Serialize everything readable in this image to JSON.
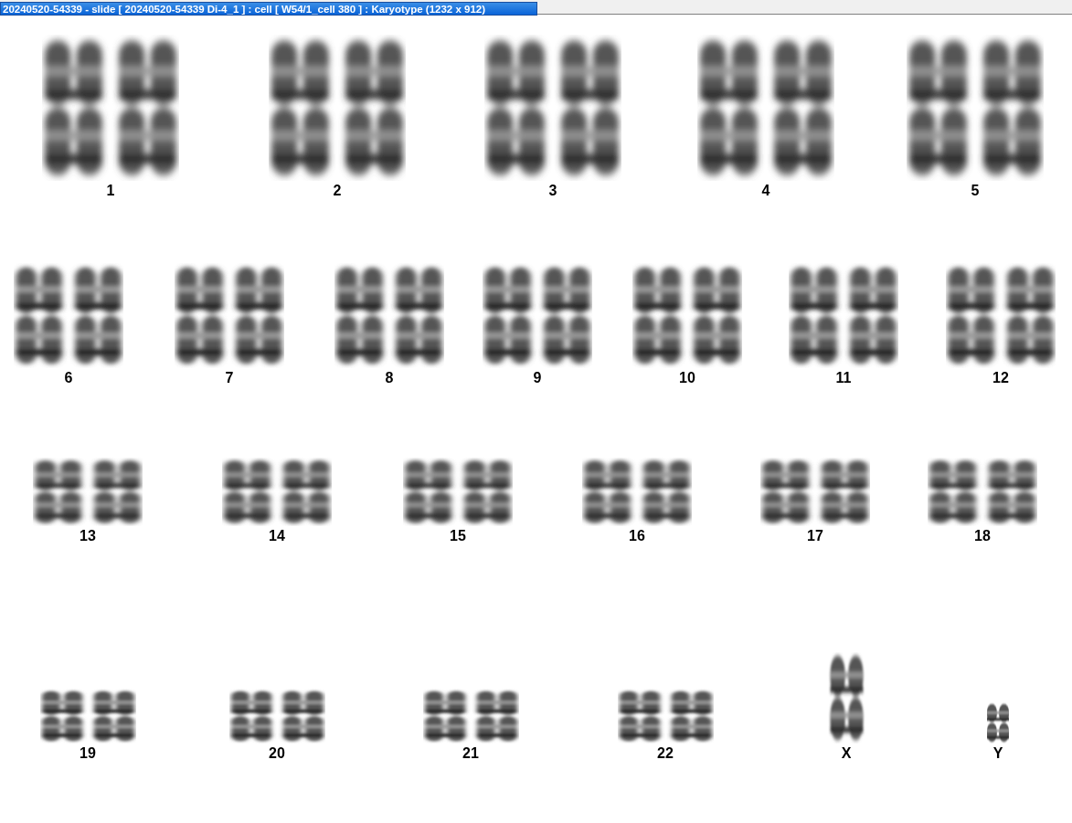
{
  "window": {
    "title": "20240520-54339 - slide [ 20240520-54339 Di-4_1 ] : cell [ W54/1_cell 380 ] : Karyotype  (1232 x 912)"
  },
  "rows": [
    {
      "chromosomes": [
        {
          "label": "1",
          "kind": "pair"
        },
        {
          "label": "2",
          "kind": "pair"
        },
        {
          "label": "3",
          "kind": "pair"
        },
        {
          "label": "4",
          "kind": "pair"
        },
        {
          "label": "5",
          "kind": "pair"
        }
      ]
    },
    {
      "chromosomes": [
        {
          "label": "6",
          "kind": "pair"
        },
        {
          "label": "7",
          "kind": "pair"
        },
        {
          "label": "8",
          "kind": "pair"
        },
        {
          "label": "9",
          "kind": "pair"
        },
        {
          "label": "10",
          "kind": "pair"
        },
        {
          "label": "11",
          "kind": "pair"
        },
        {
          "label": "12",
          "kind": "pair"
        }
      ]
    },
    {
      "chromosomes": [
        {
          "label": "13",
          "kind": "pair"
        },
        {
          "label": "14",
          "kind": "pair"
        },
        {
          "label": "15",
          "kind": "pair"
        },
        {
          "label": "16",
          "kind": "pair"
        },
        {
          "label": "17",
          "kind": "pair"
        },
        {
          "label": "18",
          "kind": "pair"
        }
      ]
    },
    {
      "chromosomes": [
        {
          "label": "19",
          "kind": "pair"
        },
        {
          "label": "20",
          "kind": "pair"
        },
        {
          "label": "21",
          "kind": "pair"
        },
        {
          "label": "22",
          "kind": "pair"
        },
        {
          "label": "X",
          "kind": "single"
        },
        {
          "label": "Y",
          "kind": "single"
        }
      ]
    }
  ]
}
